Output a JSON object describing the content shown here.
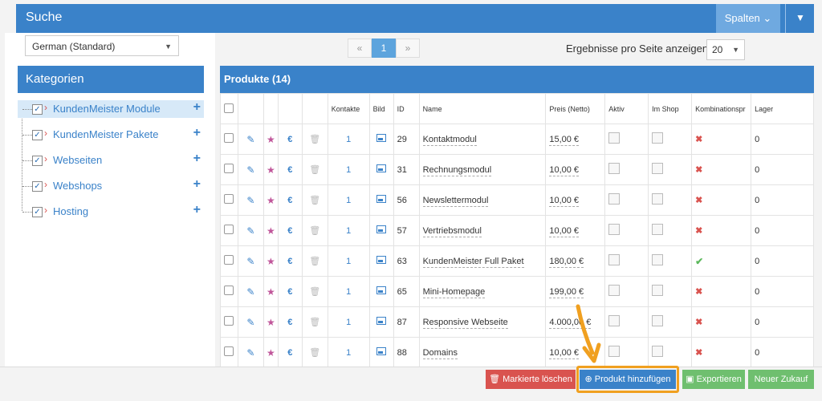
{
  "search": {
    "title": "Suche",
    "columns_button": "Spalten ⌄",
    "collapse_icon": "chevron-down-icon"
  },
  "language": {
    "selected": "German (Standard)"
  },
  "pager": {
    "prev": "«",
    "current": "1",
    "next": "»"
  },
  "per_page": {
    "label": "Ergebnisse pro Seite anzeigen",
    "value": "20"
  },
  "categories": {
    "title": "Kategorien",
    "items": [
      {
        "label": "KundenMeister Module"
      },
      {
        "label": "KundenMeister Pakete"
      },
      {
        "label": "Webseiten"
      },
      {
        "label": "Webshops"
      },
      {
        "label": "Hosting"
      }
    ]
  },
  "products": {
    "title": "Produkte (14)",
    "columns": [
      "",
      "",
      "",
      "",
      "",
      "Kontakte",
      "Bild",
      "ID",
      "Name",
      "Preis (Netto)",
      "Aktiv",
      "Im Shop",
      "Kombinationspr",
      "Lager"
    ],
    "rows": [
      {
        "kontakte": "1",
        "id": "29",
        "name": "Kontaktmodul",
        "preis": "15,00 €",
        "kombi": "x",
        "lager": "0"
      },
      {
        "kontakte": "1",
        "id": "31",
        "name": "Rechnungsmodul",
        "preis": "10,00 €",
        "kombi": "x",
        "lager": "0"
      },
      {
        "kontakte": "1",
        "id": "56",
        "name": "Newslettermodul",
        "preis": "10,00 €",
        "kombi": "x",
        "lager": "0"
      },
      {
        "kontakte": "1",
        "id": "57",
        "name": "Vertriebsmodul",
        "preis": "10,00 €",
        "kombi": "x",
        "lager": "0"
      },
      {
        "kontakte": "1",
        "id": "63",
        "name": "KundenMeister Full Paket",
        "preis": "180,00 €",
        "kombi": "check",
        "lager": "0"
      },
      {
        "kontakte": "1",
        "id": "65",
        "name": "Mini-Homepage",
        "preis": "199,00 €",
        "kombi": "x",
        "lager": "0"
      },
      {
        "kontakte": "1",
        "id": "87",
        "name": "Responsive Webseite",
        "preis": "4.000,00 €",
        "kombi": "x",
        "lager": "0"
      },
      {
        "kontakte": "1",
        "id": "88",
        "name": "Domains",
        "preis": "10,00 €",
        "kombi": "x",
        "lager": "0"
      }
    ]
  },
  "actions": {
    "delete": "Markierte löschen",
    "add": "Produkt hinzufügen",
    "export": "Exportieren",
    "new_purchase": "Neuer Zukauf"
  },
  "colors": {
    "primary": "#3a82c9",
    "danger": "#d9534f",
    "success": "#6fbf6f",
    "highlight": "#f0a020"
  }
}
